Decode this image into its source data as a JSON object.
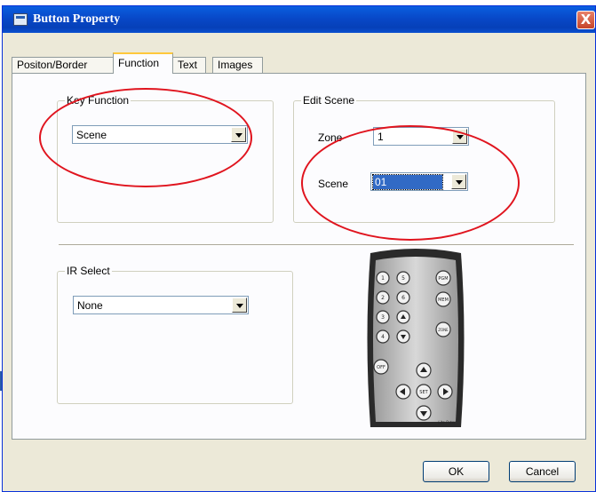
{
  "window": {
    "title": "Button Property",
    "close_glyph": "X"
  },
  "tabs": [
    {
      "label": "Positon/Border",
      "active": false
    },
    {
      "label": "Function",
      "active": true
    },
    {
      "label": "Text",
      "active": false
    },
    {
      "label": "Images",
      "active": false
    }
  ],
  "key_function": {
    "legend": "Key Function",
    "value": "Scene"
  },
  "edit_scene": {
    "legend": "Edit Scene",
    "zone_label": "Zone",
    "zone_value": "1",
    "scene_label": "Scene",
    "scene_value": "01"
  },
  "ir_select": {
    "legend": "IR Select",
    "value": "None"
  },
  "remote": {
    "buttons": {
      "b1": "1",
      "b5": "5",
      "b2": "2",
      "b6": "6",
      "b3": "3",
      "b4": "4",
      "pgm": "PGM",
      "mem": "MEM",
      "zone": "ZONE",
      "off": "OFF",
      "set": "SET"
    },
    "brand": "Lite-Puter"
  },
  "footer": {
    "ok_label": "OK",
    "cancel_label": "Cancel"
  },
  "colors": {
    "titlebar": "#0a5fe0",
    "annotation": "#e0141e",
    "selection": "#316ac5",
    "face": "#ece9d8"
  }
}
